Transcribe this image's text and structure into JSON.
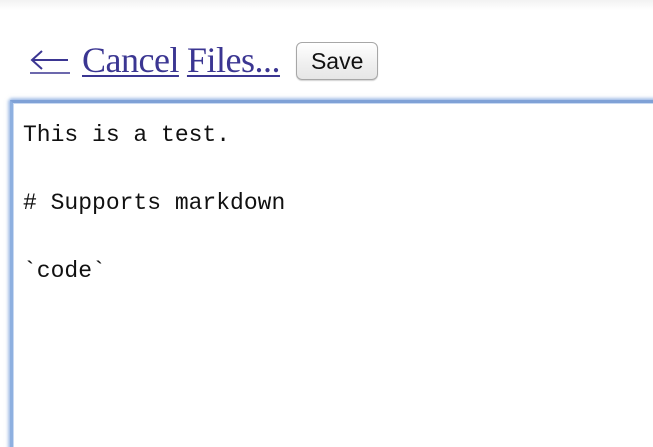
{
  "toolbar": {
    "back_icon": "left-arrow-icon",
    "cancel_label": "Cancel",
    "files_label": "Files...",
    "save_label": "Save"
  },
  "editor": {
    "content": "This is a test.\n\n# Supports markdown\n\n`code`"
  },
  "colors": {
    "link": "#3b3692",
    "focus_ring": "#7fa1d6"
  }
}
